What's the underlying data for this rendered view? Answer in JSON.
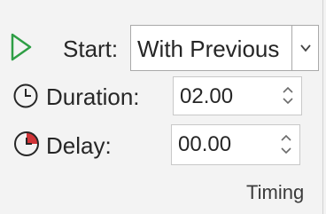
{
  "start": {
    "label": "Start:",
    "value": "With Previous"
  },
  "duration": {
    "label": "Duration:",
    "value": "02.00"
  },
  "delay": {
    "label": "Delay:",
    "value": "00.00"
  },
  "group": {
    "label": "Timing"
  },
  "icons": {
    "start": "play-triangle-icon",
    "duration": "clock-icon",
    "delay": "delay-clock-icon",
    "dropdown": "chevron-down-icon",
    "spin_up": "chevron-up-icon",
    "spin_down": "chevron-down-icon"
  },
  "colors": {
    "play": "#2e9e45",
    "delay_accent": "#d13438",
    "text": "#262626"
  }
}
